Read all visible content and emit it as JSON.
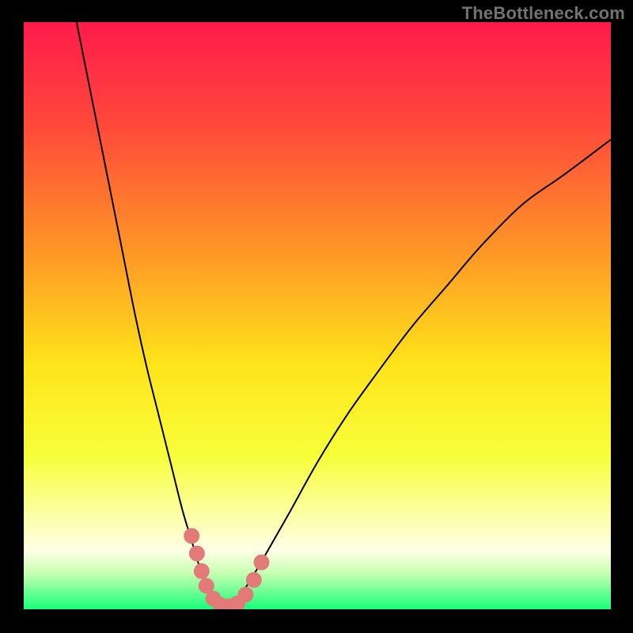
{
  "watermark": "TheBottleneck.com",
  "chart_data": {
    "type": "line",
    "title": "",
    "xlabel": "",
    "ylabel": "",
    "xlim": [
      0,
      100
    ],
    "ylim": [
      0,
      100
    ],
    "grid": false,
    "legend": false,
    "background_gradient": {
      "stops": [
        {
          "pos": 0.0,
          "color": "#ff1a4c"
        },
        {
          "pos": 0.18,
          "color": "#ff4a3a"
        },
        {
          "pos": 0.4,
          "color": "#ff9a25"
        },
        {
          "pos": 0.58,
          "color": "#ffe31a"
        },
        {
          "pos": 0.74,
          "color": "#f7ff3a"
        },
        {
          "pos": 0.84,
          "color": "#fcffa6"
        },
        {
          "pos": 0.9,
          "color": "#ffffe6"
        },
        {
          "pos": 0.94,
          "color": "#c4ffb0"
        },
        {
          "pos": 1.0,
          "color": "#17ff7a"
        }
      ]
    },
    "series": [
      {
        "name": "left-branch",
        "color": "#000000",
        "x": [
          9,
          11,
          13,
          15,
          17,
          19,
          21,
          23,
          25,
          27,
          28.5,
          30,
          31,
          32,
          33,
          34
        ],
        "y": [
          100,
          90,
          80,
          70,
          60,
          50,
          41,
          33,
          25,
          17,
          12,
          7,
          4,
          2,
          1,
          0.3
        ]
      },
      {
        "name": "right-branch",
        "color": "#000000",
        "x": [
          34,
          36,
          38,
          41,
          45,
          50,
          55,
          60,
          66,
          72,
          78,
          85,
          92,
          100
        ],
        "y": [
          0.3,
          1.5,
          4,
          9,
          16,
          25,
          33,
          40,
          48,
          55,
          62,
          69,
          74,
          80
        ]
      }
    ],
    "markers": {
      "name": "highlight-points",
      "color": "#e27a78",
      "radius": 10,
      "points": [
        {
          "x": 28.6,
          "y": 12.5
        },
        {
          "x": 29.5,
          "y": 9.5
        },
        {
          "x": 30.3,
          "y": 6.5
        },
        {
          "x": 31.1,
          "y": 4.0
        },
        {
          "x": 32.3,
          "y": 1.8
        },
        {
          "x": 33.6,
          "y": 0.7
        },
        {
          "x": 35.0,
          "y": 0.5
        },
        {
          "x": 36.4,
          "y": 1.0
        },
        {
          "x": 37.8,
          "y": 2.5
        },
        {
          "x": 39.2,
          "y": 5.0
        },
        {
          "x": 40.5,
          "y": 8.0
        }
      ]
    }
  }
}
